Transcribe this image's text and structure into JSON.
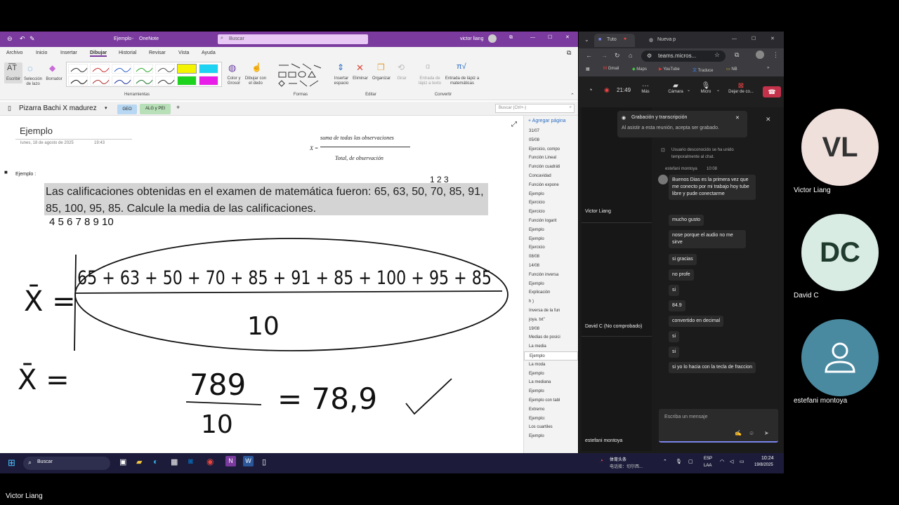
{
  "onenote": {
    "title_doc": "Ejemplo",
    "title_app": "OneNote",
    "search_placeholder": "Buscar",
    "user": "victor liang",
    "menu": [
      "Archivo",
      "Inicio",
      "Insertar",
      "Dibujar",
      "Historial",
      "Revisar",
      "Vista",
      "Ayuda"
    ],
    "active_menu": "Dibujar",
    "ribbon": {
      "escribir": "Escribir",
      "seleccion": "Selección de lazo",
      "borrador": "Borrador",
      "color_grosor": "Color y Grosor",
      "dibujar_dedo": "Dibujar con el dedo",
      "herramientas": "Herramientas",
      "formas": "Formas",
      "insertar_espacio": "Insertar espacio",
      "eliminar": "Eliminar",
      "organizar": "Organizar",
      "girar": "Girar",
      "editar": "Editar",
      "entrada_lapiz_texto": "Entrada de lápiz a texto",
      "entrada_lapiz_mat": "Entrada de lápiz a matemáticas",
      "convertir": "Convertir"
    },
    "notebook": "Pizarra Bachi X madurez",
    "sections": [
      "GEO",
      "ALG y PEI"
    ],
    "add_section": "+",
    "search_page_placeholder": "Buscar (Ctrl+-)",
    "add_page": "Agregar página",
    "page_title": "Ejemplo",
    "page_date": "lunes, 18 de agosto de 2025",
    "page_time": "19:43",
    "formula_top": "suma de todas las observaciones",
    "formula_x": "X =",
    "formula_bottom": "Total, de observación",
    "bullet_label": "Ejemplo :",
    "problem_text": "Las calificaciones obtenidas en el examen  de matemática fueron: 65, 63, 50, 70, 85, 91, 85, 100, 95, 85. Calcule la media de las calificaciones.",
    "pages": [
      "31/07",
      "05/08",
      "Ejercicio, compo",
      "Función Lineal",
      "Función cuadráti",
      "Concavidad",
      "Función expone",
      "Ejemplo",
      "Ejercicio",
      "Ejercicio",
      "Función logarit",
      "Ejemplo",
      "Ejemplo",
      "Ejercicio",
      "08/08",
      "14/08",
      "Función inversa",
      "Ejemplo",
      "Explicación",
      "h )",
      "Inversa de la fun",
      "joya. txt\"",
      "19/08",
      "Medias de posici",
      "La media",
      "Ejemplo",
      "La moda",
      "Ejemplo",
      "La mediana",
      "Ejemplo",
      "Ejemplo con tabl",
      "Extremo",
      "Ejemplo:",
      "Los cuartiles",
      "Ejemplo"
    ],
    "selected_page_index": 25,
    "handwriting": {
      "small_top": "1  2  3",
      "small_under": "4  5  6  7  8  9 10",
      "xbar1": "X̄ =",
      "numerator": "65 + 63  + 50 + 70 + 85 + 91 + 85 + 100 + 95 + 85",
      "denominator": "10",
      "xbar2": "X̄ =",
      "result_num": "789",
      "result_den": "10",
      "result": "= 78,9"
    }
  },
  "browser": {
    "tab1": "Tuto",
    "tab2": "Nueva p",
    "url": "teams.micros...",
    "bookmarks": [
      "Gmail",
      "Maps",
      "YouTube",
      "Traduce",
      "NB"
    ],
    "time": "21:49",
    "controls": [
      "Más",
      "Cámara",
      "Micro",
      "Dejar de co..."
    ],
    "recording_title": "Grabación y transcripción",
    "recording_sub": "Al asistir a esta reunión, acepta ser grabado.",
    "system_msg": "Usuario desconocido se ha unido temporalmente al chat.",
    "chat_author": "estefani montoya",
    "chat_time": "10:08",
    "messages": [
      "Buenos Dias es la primera vez que me conecto por mi trabajo hoy tube libre y pude conectarme",
      "mucho gusto",
      "nose porque el audio no me sirve",
      "si gracias",
      "no profe",
      "si",
      "84.9",
      "convertido en decimal",
      "si",
      "si",
      "si yo lo hacia con la tecla de fraccion"
    ],
    "tiles": [
      "Victor Liang",
      "David C (No comprobado)",
      "estefani montoya"
    ],
    "compose_placeholder": "Escriba un mensaje"
  },
  "taskbar": {
    "search": "Buscar",
    "news": "体育头条",
    "news_sub": "电话接：切尔西...",
    "lang1": "ESP",
    "lang2": "LAA",
    "time": "10:24",
    "date": "19/8/2025"
  },
  "participants": [
    {
      "initials": "VL",
      "name": "Victor Liang",
      "bg": "#f0e0dc",
      "fg": "#333"
    },
    {
      "initials": "DC",
      "name": "David C",
      "bg": "#d9ece4",
      "fg": "#1f3b2e"
    },
    {
      "initials": "",
      "name": "estefani montoya",
      "bg": "#4a8aa1",
      "fg": "#fff"
    }
  ],
  "presenter": "Victor Liang",
  "colors": {
    "onenote_purple": "#7a3a9e",
    "teams_red": "#c4314b",
    "highlight": "#d4d4d4"
  }
}
